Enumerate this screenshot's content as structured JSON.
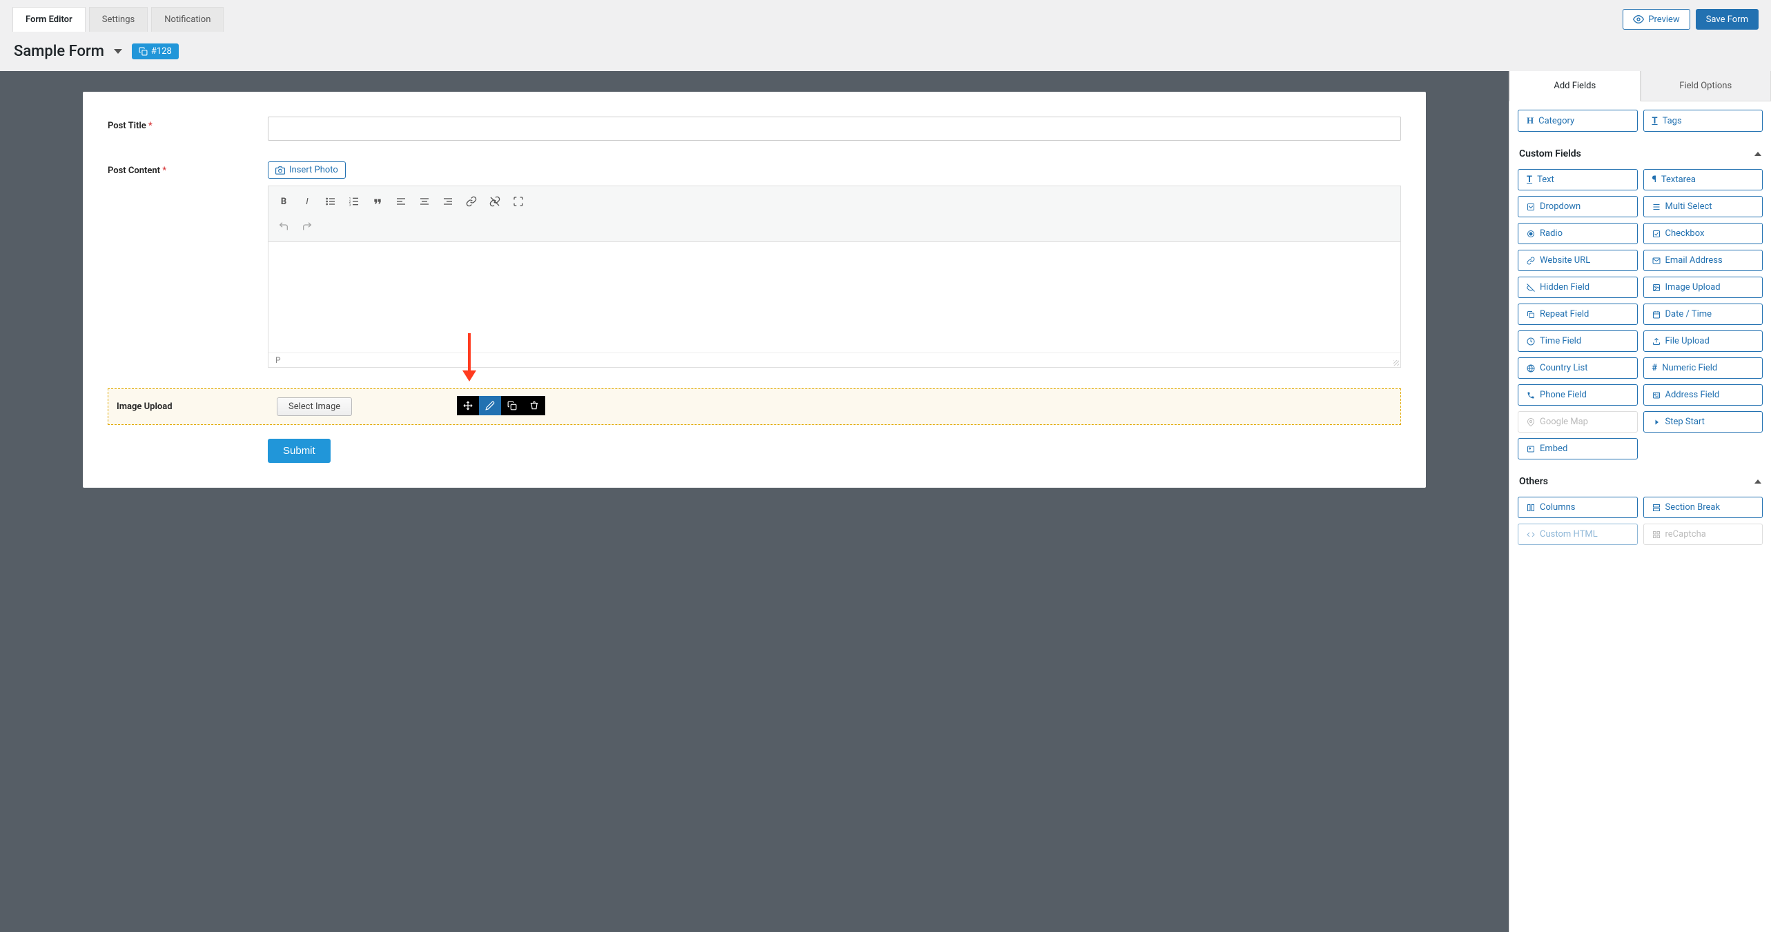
{
  "tabs": {
    "editor": "Form Editor",
    "settings": "Settings",
    "notification": "Notification"
  },
  "actions": {
    "preview": "Preview",
    "save": "Save Form"
  },
  "formTitle": "Sample Form",
  "formBadge": "#128",
  "fields": {
    "postTitle": "Post Title",
    "postContent": "Post Content",
    "insertPhoto": "Insert Photo",
    "editorFooter": "P",
    "imageUpload": "Image Upload",
    "selectImage": "Select Image",
    "submit": "Submit"
  },
  "sidebar": {
    "tabAdd": "Add Fields",
    "tabOptions": "Field Options",
    "topChips": {
      "category": "Category",
      "tags": "Tags"
    },
    "sectionCustom": "Custom Fields",
    "sectionOthers": "Others",
    "custom": {
      "text": "Text",
      "textarea": "Textarea",
      "dropdown": "Dropdown",
      "multiselect": "Multi Select",
      "radio": "Radio",
      "checkbox": "Checkbox",
      "url": "Website URL",
      "email": "Email Address",
      "hidden": "Hidden Field",
      "imageUpload": "Image Upload",
      "repeat": "Repeat Field",
      "datetime": "Date / Time",
      "time": "Time Field",
      "file": "File Upload",
      "country": "Country List",
      "numeric": "Numeric Field",
      "phone": "Phone Field",
      "address": "Address Field",
      "map": "Google Map",
      "step": "Step Start",
      "embed": "Embed"
    },
    "others": {
      "columns": "Columns",
      "section": "Section Break",
      "html": "Custom HTML",
      "recaptcha": "reCaptcha"
    }
  }
}
